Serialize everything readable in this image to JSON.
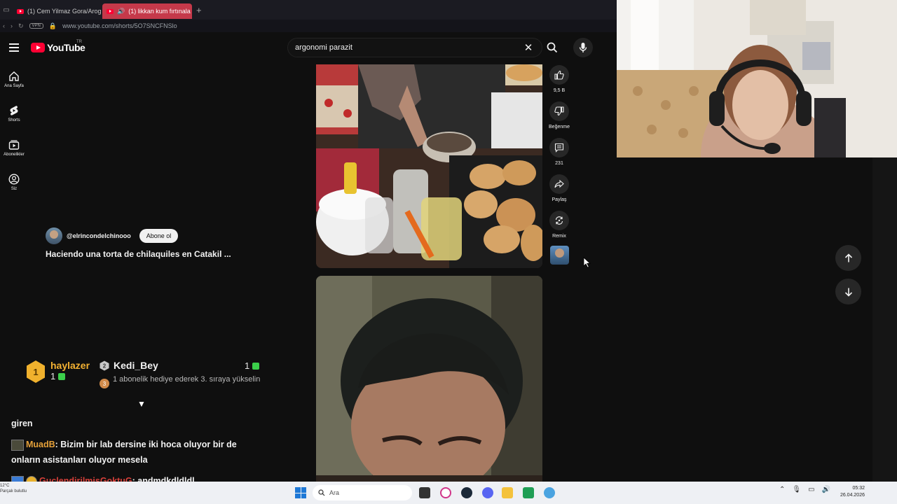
{
  "browser": {
    "tabs": [
      {
        "title": "(1) Cem Yilmaz Gora/Arog",
        "active": false
      },
      {
        "title": "(1) likkan kum fırtınala",
        "active": true
      }
    ],
    "url": "www.youtube.com/shorts/5O7SNCFNSlo",
    "vpn_label": "VPN"
  },
  "youtube": {
    "logo_text": "YouTube",
    "region": "TR",
    "search_value": "argonomi parazit",
    "nav": [
      {
        "label": "Ana Sayfa",
        "icon": "home-icon"
      },
      {
        "label": "Shorts",
        "icon": "shorts-icon"
      },
      {
        "label": "Abonelikler",
        "icon": "subscriptions-icon"
      },
      {
        "label": "Siz",
        "icon": "user-icon"
      }
    ],
    "short": {
      "channel": "@elrincondelchinooo",
      "subscribe_label": "Abone ol",
      "title": "Haciendo una torta de chilaquiles en Catakil ..."
    },
    "actions": {
      "like_count": "9,5 B",
      "dislike_label": "Beğenme",
      "comment_count": "231",
      "share_label": "Paylaş",
      "remix_label": "Remix"
    }
  },
  "overlay": {
    "top1": {
      "rank": "1",
      "name": "haylazer",
      "count": "1"
    },
    "top2": {
      "rank": "2",
      "name": "Kedi_Bey",
      "count": "1",
      "rank3": "3",
      "desc": "1 abonelik hediye ederek 3. sıraya yükselin"
    }
  },
  "chat": [
    {
      "user": "",
      "text": "giren"
    },
    {
      "user": "MuadB",
      "text": ": Bizim bir lab dersine iki hoca oluyor bir de"
    },
    {
      "user": "",
      "text": "onların asistanları oluyor mesela"
    },
    {
      "user": "GuclendirilmisGoktuG",
      "text": ": andmdkdldldl"
    },
    {
      "user": "GuclendirilmisGoktuG",
      "text": ""
    }
  ],
  "taskbar": {
    "weather_temp": "12°C",
    "weather_desc": "Parçalı bulutlu",
    "search_placeholder": "Ara",
    "time": "05:32",
    "date": "26.04.2026"
  },
  "colors": {
    "youtube_red": "#ff0033",
    "active_tab": "#c5394a",
    "chat_user": "#e7a23a",
    "chat_user_red": "#d8403a",
    "page_bg": "#0f0f0f"
  }
}
